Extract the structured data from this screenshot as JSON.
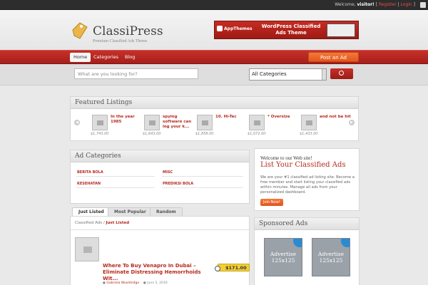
{
  "topbar": {
    "welcome_text": "Welcome,",
    "user": "visitor!",
    "register": "Register",
    "login": "Login",
    "sep1": "[",
    "sep2": "|",
    "sep3": "]"
  },
  "header": {
    "logo_title": "ClassiPress",
    "logo_subtitle": "Premium Classified Ads Theme",
    "banner_brand": "AppThemes",
    "banner_text": "WordPress Classified Ads Theme"
  },
  "nav": {
    "items": [
      {
        "label": "Home"
      },
      {
        "label": "Categories"
      },
      {
        "label": "Blog"
      }
    ],
    "post_ad": "Post an Ad"
  },
  "search": {
    "placeholder": "What are you looking for?",
    "category_selected": "All Categories"
  },
  "featured": {
    "title": "Featured Listings",
    "items": [
      {
        "title": "In the year 1985",
        "price": "$1,743.00"
      },
      {
        "title": "spying software can log your k...",
        "price": "$1,643.00"
      },
      {
        "title": "10. Hi-Tec",
        "price": "$1,858.00"
      },
      {
        "title": "* Oversize",
        "price": "$1,072.00"
      },
      {
        "title": "and not be hit",
        "price": "$1,433.00"
      }
    ]
  },
  "ad_categories": {
    "title": "Ad Categories",
    "items": [
      "BERITA BOLA",
      "MISC",
      "KESEHATAN",
      "PREDIKSI BOLA"
    ]
  },
  "welcome_box": {
    "heading": "Welcome to our Web site!",
    "title": "List Your Classified Ads",
    "text": "We are your #1 classified ad listing site. Become a free member and start listing your classified ads within minutes. Manage all ads from your personalized dashboard.",
    "join": "Join Now!"
  },
  "tabs": [
    "Just Listed",
    "Most Popular",
    "Random"
  ],
  "listing": {
    "crumb_root": "Classified Ads",
    "crumb_sep": "/",
    "crumb_current": "Just Listed",
    "title": "Where To Buy Venapro In Dubai – Eliminate Distressing Hemorrhoids Wit...",
    "price": "$171.00",
    "author": "Gabriela Wooldridge",
    "date": "June 5, 2016"
  },
  "sponsored": {
    "title": "Sponsored Ads",
    "ads": [
      "Advertise 125x125",
      "Advertise 125x125"
    ]
  }
}
